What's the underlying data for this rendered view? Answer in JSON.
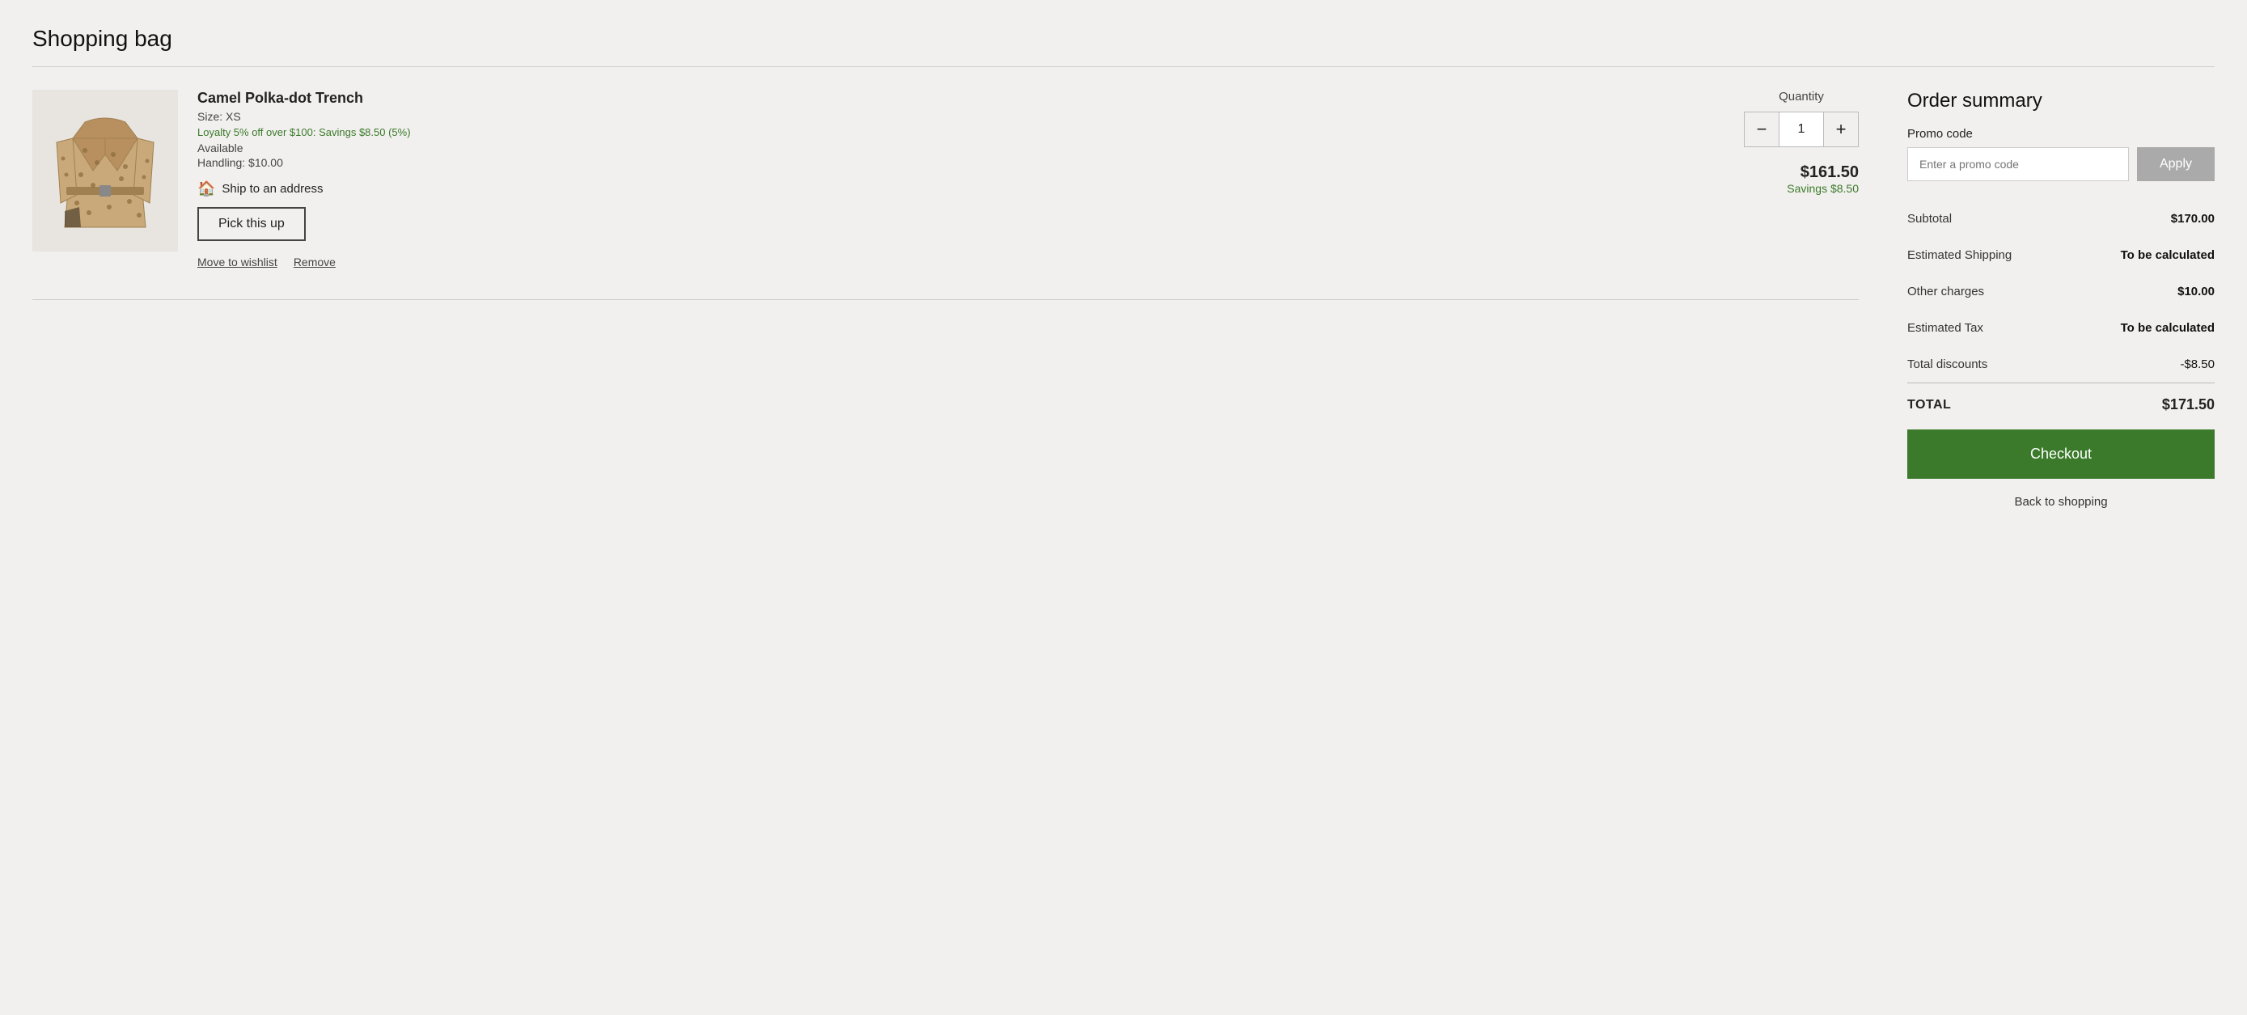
{
  "page": {
    "title": "Shopping bag"
  },
  "cart": {
    "item": {
      "name": "Camel Polka-dot Trench",
      "size_label": "Size: XS",
      "loyalty_text": "Loyalty 5% off over $100: Savings $8.50 (5%)",
      "availability": "Available",
      "handling": "Handling: $10.00",
      "ship_label": "Ship to an address",
      "pickup_label": "Pick this up",
      "quantity_label": "Quantity",
      "quantity_value": "1",
      "price": "$161.50",
      "savings": "Savings $8.50",
      "move_to_wishlist": "Move to wishlist",
      "remove": "Remove",
      "qty_minus": "−",
      "qty_plus": "+"
    }
  },
  "order_summary": {
    "title": "Order summary",
    "promo_label": "Promo code",
    "promo_placeholder": "Enter a promo code",
    "apply_button": "Apply",
    "rows": [
      {
        "label": "Subtotal",
        "value": "$170.00",
        "bold": true
      },
      {
        "label": "Estimated Shipping",
        "value": "To be calculated",
        "bold": true
      },
      {
        "label": "Other charges",
        "value": "$10.00",
        "bold": true
      },
      {
        "label": "Estimated Tax",
        "value": "To be calculated",
        "bold": true
      },
      {
        "label": "Total discounts",
        "value": "-$8.50",
        "bold": false
      }
    ],
    "total_label": "TOTAL",
    "total_value": "$171.50",
    "checkout_label": "Checkout",
    "back_label": "Back to shopping"
  },
  "icons": {
    "ship": "🏠",
    "minus": "−",
    "plus": "+"
  }
}
